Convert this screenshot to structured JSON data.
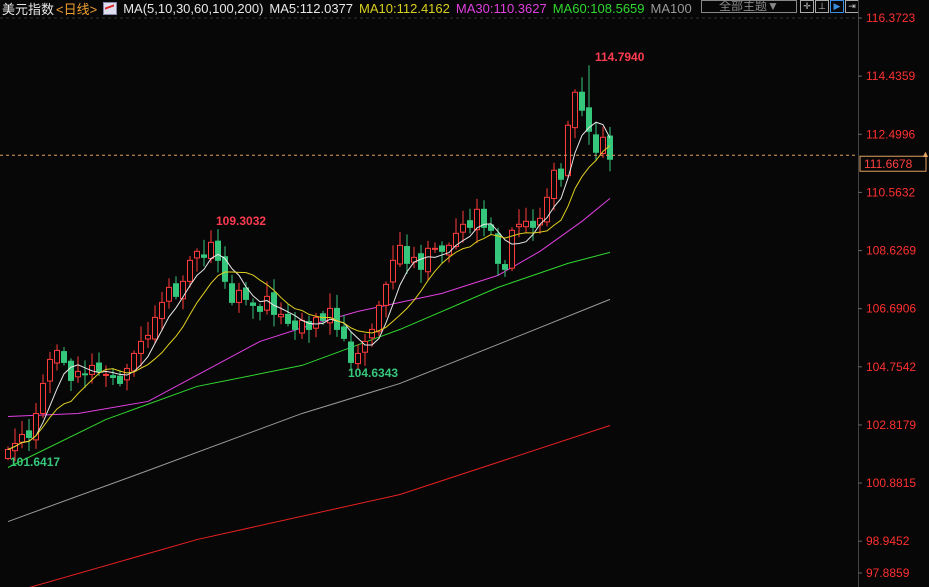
{
  "header": {
    "title": "美元指数",
    "period": "<日线>",
    "ma_params": "MA(5,10,30,60,100,200)",
    "ma5": "MA5:112.0377",
    "ma10": "MA10:112.4162",
    "ma30": "MA30:110.3627",
    "ma60": "MA60:108.5659",
    "ma100": "MA100",
    "theme_button": "全部主题▼",
    "tools": [
      "crosshair-icon",
      "range-icon",
      "play-icon",
      "export-icon"
    ]
  },
  "colors": {
    "up": "#ff3b3b",
    "down": "#35c77c",
    "ma5": "#e8e8e8",
    "ma10": "#e0d020",
    "ma30": "#e040e0",
    "ma60": "#30d830",
    "ma100": "#9a9a9a",
    "ma200": "#e82020"
  },
  "chart_data": {
    "type": "candlestick",
    "title": "美元指数 日线",
    "ylim": [
      97.8859,
      116.3723
    ],
    "y_ticks": [
      "116.3723",
      "114.4359",
      "112.4996",
      "110.5632",
      "108.6269",
      "106.6906",
      "104.7542",
      "102.8179",
      "100.8815",
      "98.9452",
      "97.8859"
    ],
    "current_price": "111.6678",
    "annotations": {
      "high": "114.7940",
      "local_high": "109.3032",
      "local_low": "104.6343",
      "low": "101.6417"
    },
    "closes": [
      102.0,
      102.2,
      102.5,
      102.4,
      103.2,
      104.2,
      105.0,
      105.3,
      104.9,
      104.3,
      104.6,
      104.5,
      104.8,
      104.6,
      104.5,
      104.4,
      104.2,
      104.7,
      105.2,
      105.6,
      105.8,
      106.4,
      106.9,
      107.4,
      107.1,
      107.6,
      108.3,
      108.6,
      108.4,
      108.9,
      108.3,
      107.6,
      106.9,
      107.3,
      107.0,
      106.8,
      106.6,
      107.1,
      106.5,
      106.5,
      106.2,
      106.0,
      106.3,
      106.0,
      106.4,
      106.3,
      106.7,
      106.0,
      105.7,
      104.9,
      105.2,
      105.6,
      106.0,
      106.8,
      107.5,
      108.3,
      108.8,
      108.2,
      108.4,
      108.0,
      108.7,
      108.7,
      108.6,
      108.8,
      109.2,
      109.5,
      109.4,
      110.0,
      109.4,
      109.3,
      108.2,
      108.0,
      109.3,
      109.5,
      109.6,
      109.4,
      109.7,
      110.4,
      111.3,
      111.0,
      112.8,
      113.9,
      113.3,
      112.6,
      111.9,
      112.4,
      111.6678
    ],
    "ma_series": {
      "MA30": [
        [
          0,
          103.1
        ],
        [
          10,
          103.2
        ],
        [
          20,
          103.6
        ],
        [
          28,
          104.6
        ],
        [
          36,
          105.6
        ],
        [
          44,
          106.2
        ],
        [
          50,
          106.6
        ],
        [
          56,
          106.9
        ],
        [
          62,
          107.2
        ],
        [
          70,
          107.8
        ],
        [
          76,
          108.6
        ],
        [
          82,
          109.6
        ],
        [
          86,
          110.3627
        ]
      ],
      "MA60": [
        [
          0,
          101.4
        ],
        [
          14,
          103.0
        ],
        [
          27,
          104.1
        ],
        [
          42,
          104.8
        ],
        [
          56,
          106.0
        ],
        [
          70,
          107.4
        ],
        [
          80,
          108.2
        ],
        [
          86,
          108.5659
        ]
      ],
      "MA100": [
        [
          0,
          99.6
        ],
        [
          20,
          101.3
        ],
        [
          42,
          103.2
        ],
        [
          56,
          104.2
        ],
        [
          70,
          105.5
        ],
        [
          86,
          107.0
        ]
      ],
      "MA200": [
        [
          3,
          97.4
        ],
        [
          27,
          99.0
        ],
        [
          56,
          100.5
        ],
        [
          86,
          102.8
        ]
      ]
    }
  }
}
